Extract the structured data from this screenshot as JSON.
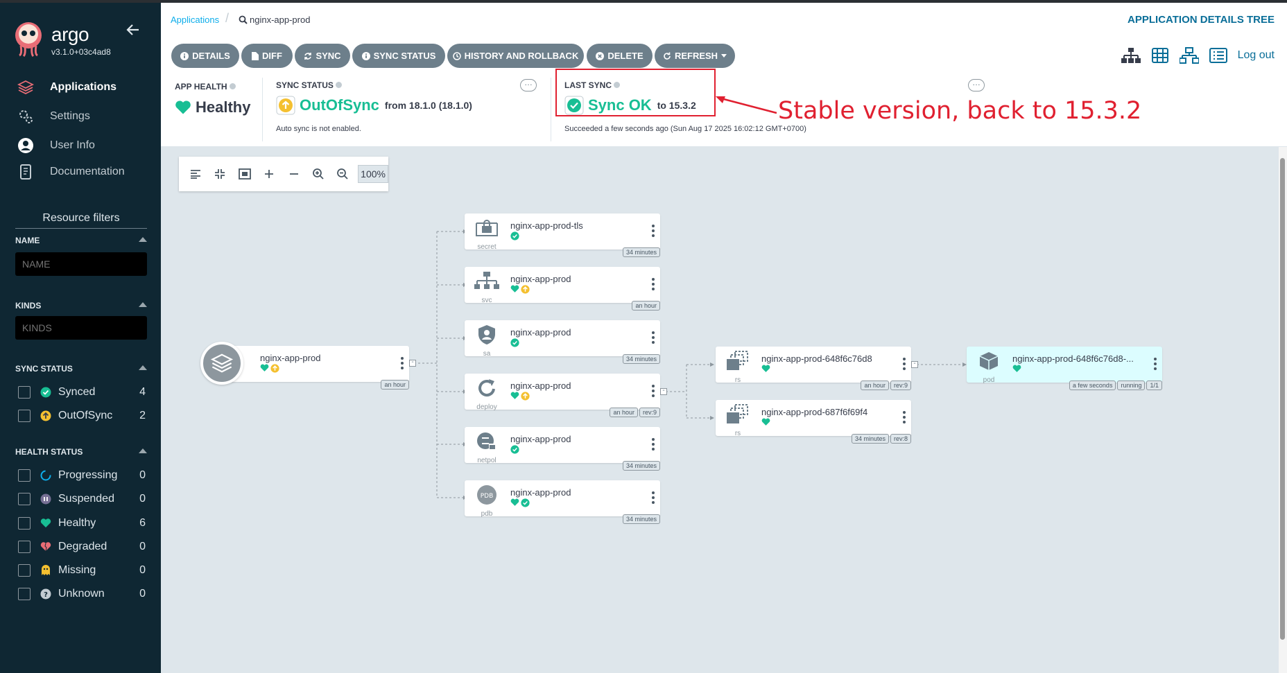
{
  "sidebar": {
    "brand": "argo",
    "version": "v3.1.0+03c4ad8",
    "nav": [
      {
        "label": "Applications",
        "icon": "layers-icon"
      },
      {
        "label": "Settings",
        "icon": "gears-icon"
      },
      {
        "label": "User Info",
        "icon": "user-circle-icon"
      },
      {
        "label": "Documentation",
        "icon": "book-icon"
      }
    ],
    "resource_filters_title": "Resource filters",
    "name_label": "NAME",
    "name_placeholder": "NAME",
    "kinds_label": "KINDS",
    "kinds_placeholder": "KINDS",
    "sync_status_label": "SYNC STATUS",
    "sync_items": [
      {
        "label": "Synced",
        "count": "4"
      },
      {
        "label": "OutOfSync",
        "count": "2"
      }
    ],
    "health_status_label": "HEALTH STATUS",
    "health_items": [
      {
        "label": "Progressing",
        "count": "0"
      },
      {
        "label": "Suspended",
        "count": "0"
      },
      {
        "label": "Healthy",
        "count": "6"
      },
      {
        "label": "Degraded",
        "count": "0"
      },
      {
        "label": "Missing",
        "count": "0"
      },
      {
        "label": "Unknown",
        "count": "0"
      }
    ]
  },
  "breadcrumb": {
    "root": "Applications",
    "current": "nginx-app-prod"
  },
  "page_title": "APPLICATION DETAILS TREE",
  "toolbar": {
    "buttons": [
      "DETAILS",
      "DIFF",
      "SYNC",
      "SYNC STATUS",
      "HISTORY AND ROLLBACK",
      "DELETE",
      "REFRESH"
    ],
    "logout": "Log out"
  },
  "status": {
    "app_health_label": "APP HEALTH",
    "app_health_value": "Healthy",
    "sync_status_label": "SYNC STATUS",
    "sync_status_value": "OutOfSync",
    "sync_from": "from 18.1.0 (18.1.0)",
    "auto_sync_note": "Auto sync is not enabled.",
    "last_sync_label": "LAST SYNC",
    "last_sync_value": "Sync OK",
    "last_sync_to": "to 15.3.2",
    "last_sync_detail": "Succeeded a few seconds ago (Sun Aug 17 2025 16:02:12 GMT+0700)"
  },
  "annotation": "Stable version, back to 15.3.2",
  "zoom": "100%",
  "colors": {
    "synced": "#18be94",
    "outofsync": "#f4c030",
    "healthy": "#18be94",
    "accent": "#0a6e98",
    "annotation": "#e02030"
  },
  "tree": {
    "app": {
      "name": "nginx-app-prod",
      "tags": [
        "an hour"
      ]
    },
    "children": [
      {
        "name": "nginx-app-prod-tls",
        "kind": "secret",
        "tags": [
          "34 minutes"
        ]
      },
      {
        "name": "nginx-app-prod",
        "kind": "svc",
        "tags": [
          "an hour"
        ]
      },
      {
        "name": "nginx-app-prod",
        "kind": "sa",
        "tags": [
          "34 minutes"
        ]
      },
      {
        "name": "nginx-app-prod",
        "kind": "deploy",
        "tags": [
          "an hour",
          "rev:9"
        ]
      },
      {
        "name": "nginx-app-prod",
        "kind": "netpol",
        "tags": [
          "34 minutes"
        ]
      },
      {
        "name": "nginx-app-prod",
        "kind": "pdb",
        "tags": [
          "34 minutes"
        ]
      }
    ],
    "replicasets": [
      {
        "name": "nginx-app-prod-648f6c76d8",
        "kind": "rs",
        "tags": [
          "an hour",
          "rev:9"
        ]
      },
      {
        "name": "nginx-app-prod-687f6f69f4",
        "kind": "rs",
        "tags": [
          "34 minutes",
          "rev:8"
        ]
      }
    ],
    "pod": {
      "name": "nginx-app-prod-648f6c76d8-...",
      "kind": "pod",
      "tags": [
        "a few seconds",
        "running",
        "1/1"
      ]
    }
  }
}
